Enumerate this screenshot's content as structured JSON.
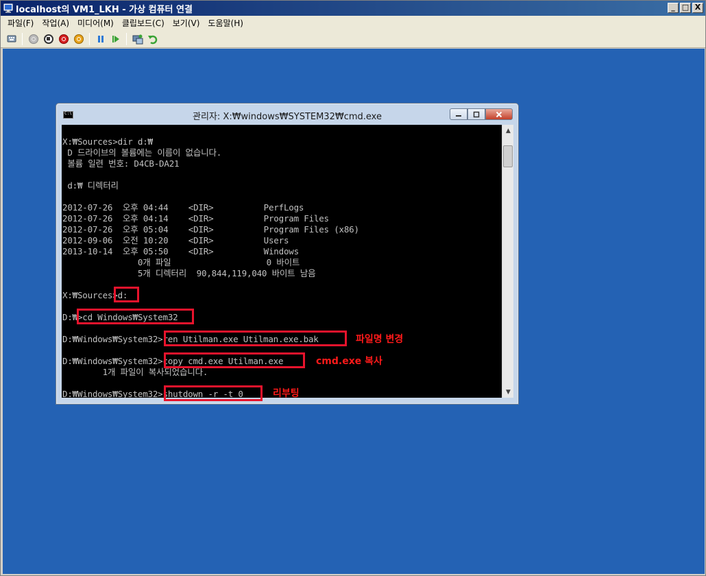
{
  "outer_window": {
    "title": "localhost의 VM1_LKH - 가상 컴퓨터 연결",
    "caption_minimize": "_",
    "caption_restore": "□",
    "caption_close": "X",
    "menu": [
      "파일(F)",
      "작업(A)",
      "미디어(M)",
      "클립보드(C)",
      "보기(V)",
      "도움말(H)"
    ],
    "toolbar_icons": [
      "ctrl-alt-del-icon",
      "start-icon",
      "turn-off-icon",
      "shutdown-icon",
      "power-icon",
      "pause-icon",
      "resume-icon",
      "snapshot-icon",
      "revert-icon"
    ]
  },
  "cmd_window": {
    "title": "관리자: X:₩windows₩SYSTEM32₩cmd.exe",
    "lines": [
      "X:₩Sources>dir d:₩",
      " D 드라이브의 볼륨에는 이름이 없습니다.",
      " 볼륨 일련 번호: D4CB-DA21",
      "",
      " d:₩ 디렉터리",
      "",
      "2012-07-26  오후 04:44    <DIR>          PerfLogs",
      "2012-07-26  오후 04:14    <DIR>          Program Files",
      "2012-07-26  오후 05:04    <DIR>          Program Files (x86)",
      "2012-09-06  오전 10:20    <DIR>          Users",
      "2013-10-14  오후 05:50    <DIR>          Windows",
      "               0개 파일                   0 바이트",
      "               5개 디렉터리  90,844,119,040 바이트 남음",
      "",
      "X:₩Sources>d:",
      "",
      "D:₩>cd Windows₩System32",
      "",
      "D:₩Windows₩System32>ren Utilman.exe Utilman.exe.bak",
      "",
      "D:₩Windows₩System32>copy cmd.exe Utilman.exe",
      "        1개 파일이 복사되었습니다.",
      "",
      "D:₩Windows₩System32>shutdown -r -t 0"
    ]
  },
  "annotations": {
    "rename": "파일명 변경",
    "copy": "cmd.exe 복사",
    "reboot": "리부팅"
  },
  "colors": {
    "desktop": "#2462b4",
    "highlight": "#e8132c",
    "annotation_text": "#ff1a1a"
  }
}
